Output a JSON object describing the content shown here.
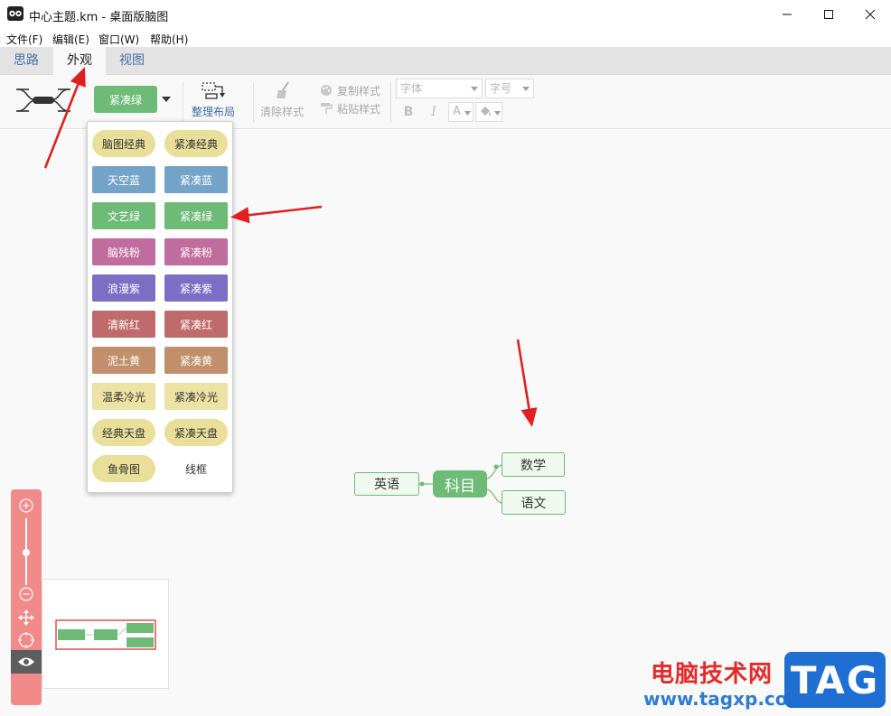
{
  "window": {
    "title": "中心主题.km - 桌面版脑图"
  },
  "menu": [
    "文件(F)",
    "编辑(E)",
    "窗口(W)",
    "帮助(H)"
  ],
  "tabs": [
    "思路",
    "外观",
    "视图"
  ],
  "toolbar": {
    "theme_value": "紧凑绿",
    "reorganize_label": "整理布局",
    "clear_style_label": "清除样式",
    "copy_style_label": "复制样式",
    "paste_style_label": "粘贴样式",
    "font_placeholder": "字体",
    "size_placeholder": "字号",
    "bold_label": "B",
    "italic_label": "I",
    "font_color_label": "A"
  },
  "theme_options": [
    {
      "label": "脑图经典",
      "bg": "#e9df9a",
      "fg": "#333333",
      "shape": "pill"
    },
    {
      "label": "紧凑经典",
      "bg": "#e9df9a",
      "fg": "#333333",
      "shape": "pill"
    },
    {
      "label": "天空蓝",
      "bg": "#73a3c6",
      "fg": "#ffffff",
      "shape": "rect"
    },
    {
      "label": "紧凑蓝",
      "bg": "#73a3c6",
      "fg": "#ffffff",
      "shape": "rect"
    },
    {
      "label": "文艺绿",
      "bg": "#6dbb76",
      "fg": "#ffffff",
      "shape": "rect"
    },
    {
      "label": "紧凑绿",
      "bg": "#6dbb76",
      "fg": "#ffffff",
      "shape": "rect"
    },
    {
      "label": "脑残粉",
      "bg": "#c06c9e",
      "fg": "#ffffff",
      "shape": "rect"
    },
    {
      "label": "紧凑粉",
      "bg": "#c06c9e",
      "fg": "#ffffff",
      "shape": "rect"
    },
    {
      "label": "浪漫紫",
      "bg": "#7d6ec5",
      "fg": "#ffffff",
      "shape": "rect"
    },
    {
      "label": "紧凑紫",
      "bg": "#7d6ec5",
      "fg": "#ffffff",
      "shape": "rect"
    },
    {
      "label": "清新红",
      "bg": "#c06b6b",
      "fg": "#ffffff",
      "shape": "rect"
    },
    {
      "label": "紧凑红",
      "bg": "#c06b6b",
      "fg": "#ffffff",
      "shape": "rect"
    },
    {
      "label": "泥土黄",
      "bg": "#c28f6c",
      "fg": "#ffffff",
      "shape": "rect"
    },
    {
      "label": "紧凑黄",
      "bg": "#c28f6c",
      "fg": "#ffffff",
      "shape": "rect"
    },
    {
      "label": "温柔冷光",
      "bg": "#ebe2a3",
      "fg": "#333333",
      "shape": "rect"
    },
    {
      "label": "紧凑冷光",
      "bg": "#ebe2a3",
      "fg": "#333333",
      "shape": "rect"
    },
    {
      "label": "经典天盘",
      "bg": "#e9df9a",
      "fg": "#333333",
      "shape": "pill"
    },
    {
      "label": "紧凑天盘",
      "bg": "#e9df9a",
      "fg": "#333333",
      "shape": "pill"
    },
    {
      "label": "鱼骨图",
      "bg": "#e9df9a",
      "fg": "#333333",
      "shape": "pill"
    },
    {
      "label": "线框",
      "bg": "#ffffff",
      "fg": "#333333",
      "shape": "rect"
    }
  ],
  "mindmap": {
    "root": "科目",
    "left_child": "英语",
    "right_children": [
      "数学",
      "语文"
    ]
  },
  "watermark": {
    "text": "电脑技术网",
    "url": "www.tagxp.com",
    "tag": "TAG"
  },
  "colors": {
    "accent_green": "#6dbb76",
    "annotation_red": "#e02020",
    "zoom_panel": "#f28a8a",
    "tab_text": "#4a6fa5"
  }
}
